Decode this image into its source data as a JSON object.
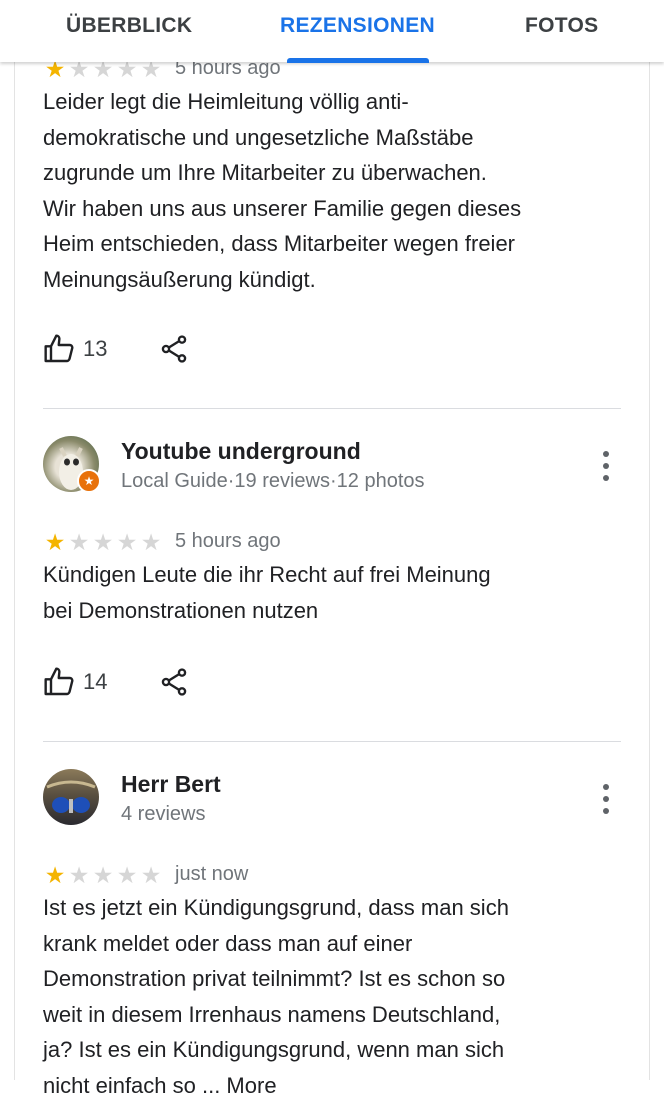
{
  "tabs": [
    {
      "label": "ÜBERBLICK"
    },
    {
      "label": "REZENSIONEN"
    },
    {
      "label": "FOTOS"
    }
  ],
  "active_tab": "REZENSIONEN",
  "colors": {
    "accent": "#1a73e8",
    "star_on": "#f4b400",
    "star_off": "#d6d6d6"
  },
  "reviews": [
    {
      "rating": 1,
      "time": "5 hours ago",
      "lines": [
        "Leider legt die Heimleitung völlig anti-",
        "demokratische und ungesetzliche Maßstäbe",
        "zugrunde um Ihre Mitarbeiter zu überwachen.",
        "Wir haben uns aus unserer Familie gegen dieses",
        "Heim entschieden, dass Mitarbeiter wegen freier",
        "Meinungsäußerung kündigt."
      ],
      "likes": "13"
    },
    {
      "author": "Youtube underground",
      "meta": "Local Guide·19 reviews·12 photos",
      "rating": 1,
      "time": "5 hours ago",
      "lines": [
        "Kündigen Leute die ihr Recht auf frei Meinung",
        "bei Demonstrationen nutzen"
      ],
      "likes": "14"
    },
    {
      "author": "Herr Bert",
      "meta": "4 reviews",
      "rating": 1,
      "time": "just now",
      "lines": [
        "Ist es jetzt ein Kündigungsgrund, dass man sich",
        "krank meldet oder dass man auf einer",
        "Demonstration privat teilnimmt? Ist es schon so",
        "weit in diesem Irrenhaus namens Deutschland,",
        "ja? Ist es ein Kündigungsgrund, wenn man sich",
        "nicht einfach so ... More"
      ]
    }
  ],
  "icons": [
    "thumbs-up-icon",
    "share-icon",
    "more-vert-icon",
    "star-icon",
    "local-guide-badge-icon"
  ]
}
